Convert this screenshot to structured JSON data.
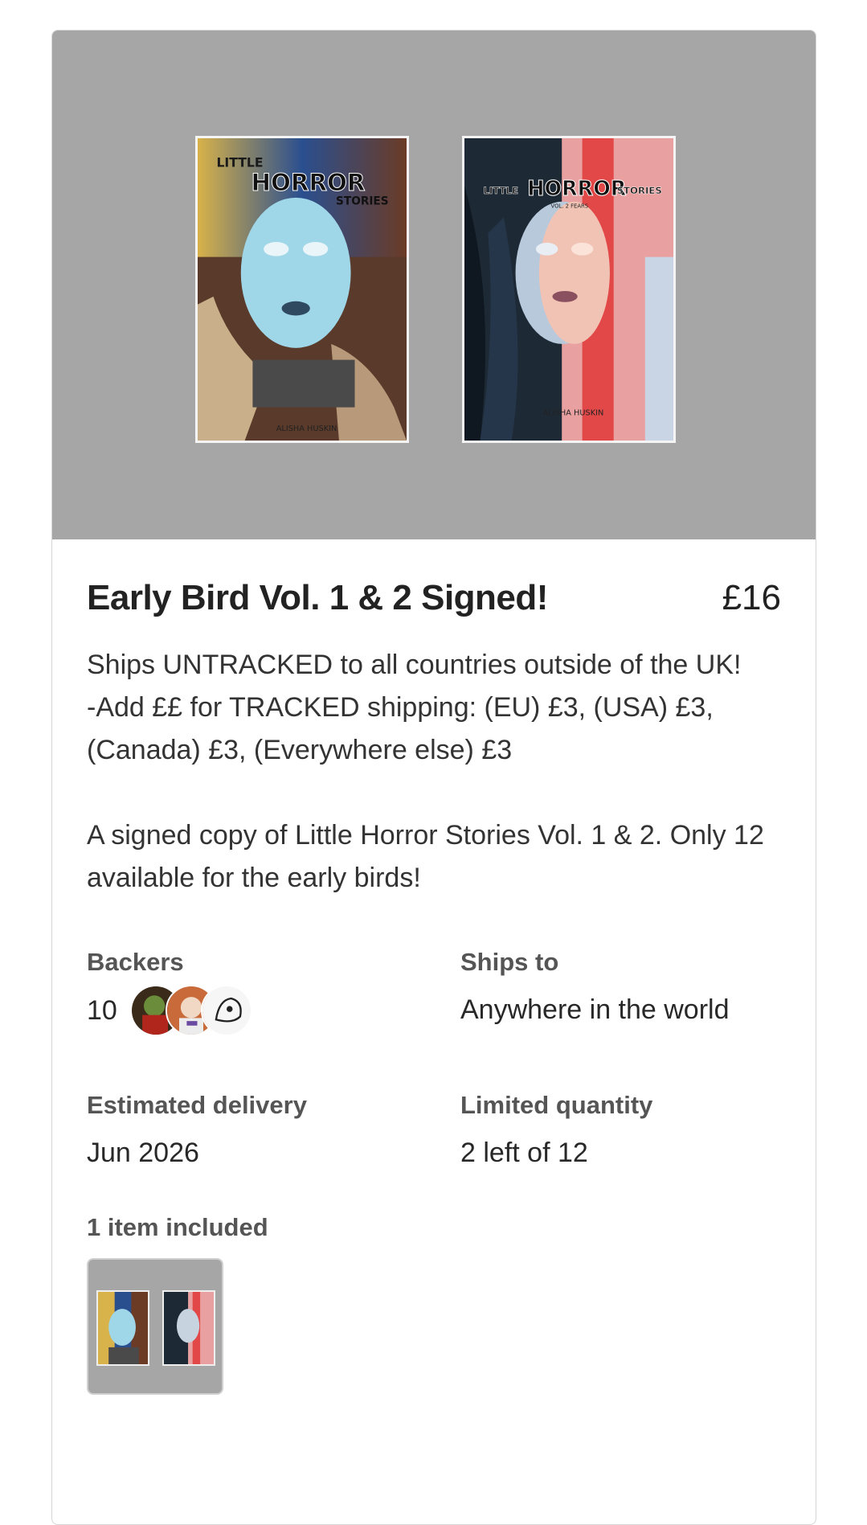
{
  "reward": {
    "cover_1": {
      "series_top": "LITTLE",
      "title": "HORROR",
      "series_bottom": "STORIES",
      "author": "ALISHA HUSKIN"
    },
    "cover_2": {
      "series_left": "LITTLE",
      "title": "HORROR",
      "series_right": "STORIES",
      "subtitle": "VOL. 2 FEARS",
      "author": "ALISHA HUSKIN"
    },
    "title": "Early Bird Vol. 1 & 2 Signed!",
    "price": "£16",
    "description": {
      "line1": "Ships UNTRACKED to all countries outside of the UK!",
      "line2": "-Add ££ for TRACKED shipping: (EU) £3, (USA) £3, (Canada) £3, (Everywhere else) £3",
      "line3": "A signed copy of Little Horror Stories Vol. 1 & 2. Only 12 available for the early birds!"
    },
    "backers": {
      "label": "Backers",
      "count": "10"
    },
    "ships_to": {
      "label": "Ships to",
      "value": "Anywhere in the world"
    },
    "estimated_delivery": {
      "label": "Estimated delivery",
      "value": "Jun 2026"
    },
    "limited_quantity": {
      "label": "Limited quantity",
      "value": "2 left of 12"
    },
    "items_included": {
      "label": "1 item included"
    }
  },
  "colors": {
    "hero_bg": "#a6a6a6",
    "card_border": "#d6d6d6",
    "text_primary": "#222222",
    "text_label": "#555555"
  },
  "icons": [
    "backer-avatar-1",
    "backer-avatar-2",
    "backer-avatar-3"
  ]
}
